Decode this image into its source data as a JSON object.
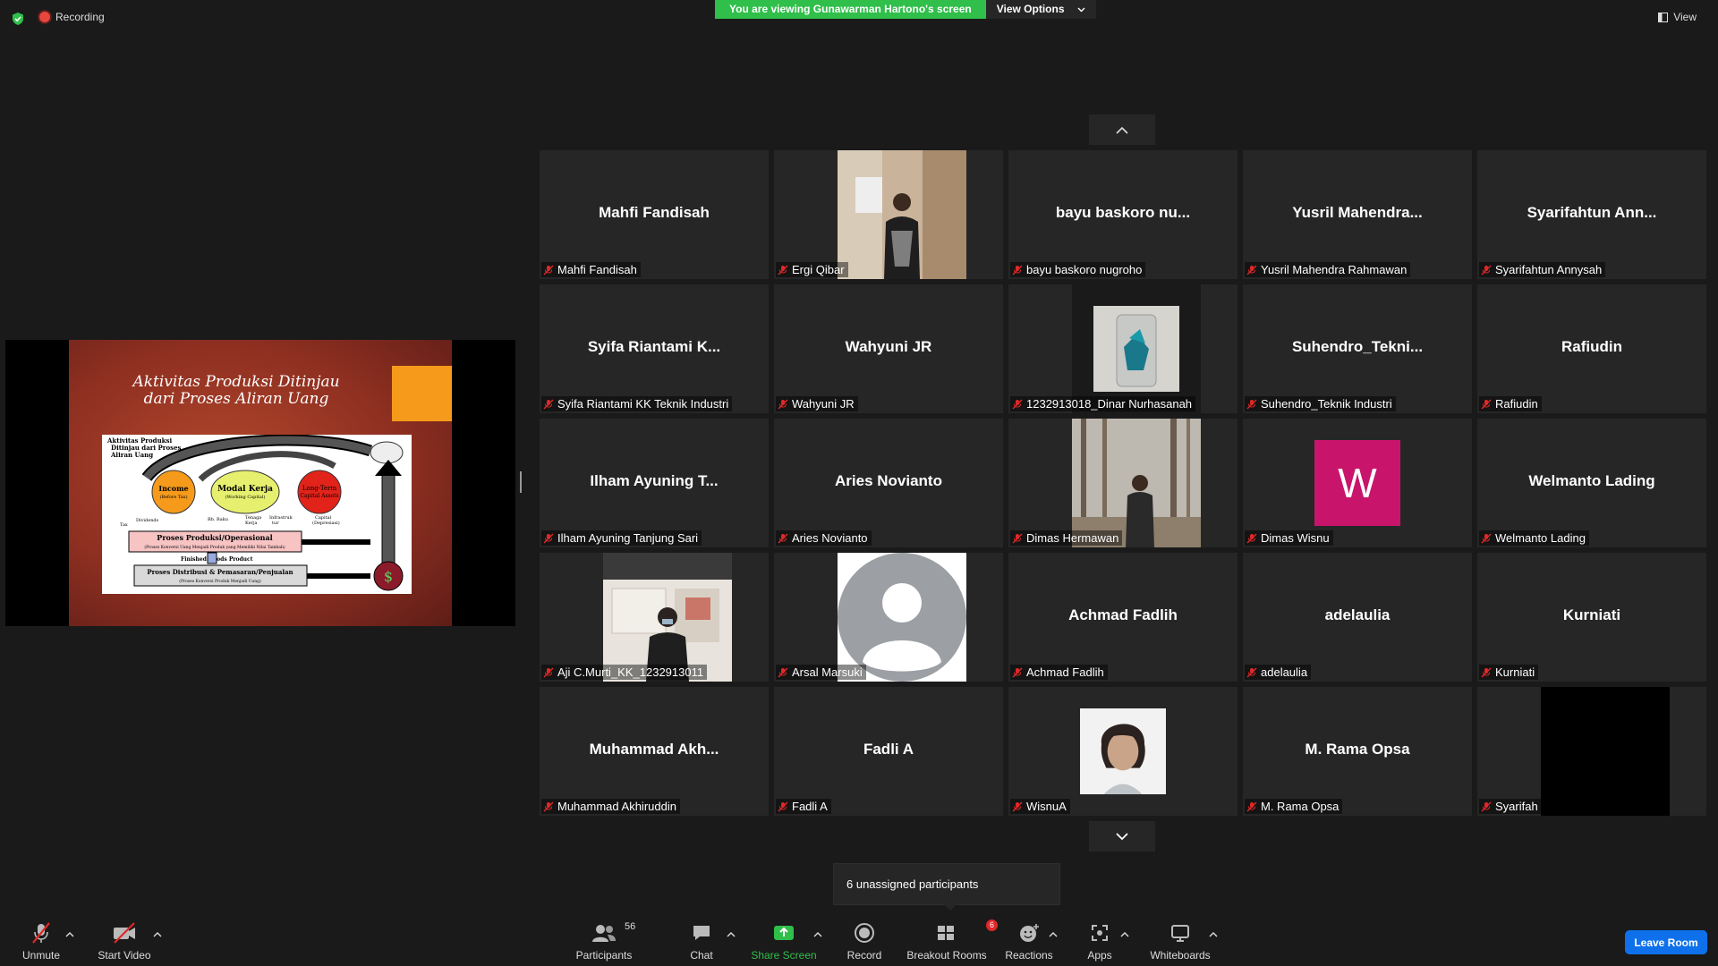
{
  "top": {
    "recording_label": "Recording",
    "banner_text": "You are viewing Gunawarman Hartono's screen",
    "view_options_label": "View Options",
    "view_label": "View"
  },
  "slide": {
    "title_line1": "Aktivitas Produksi Ditinjau",
    "title_line2": "dari Proses Aliran Uang",
    "diagram": {
      "heading1": "Aktivitas Produksi",
      "heading2": "Ditinjau dari Proses",
      "heading3": "Aliran Uang",
      "income": "Income",
      "income_sub": "(Before Tax)",
      "modal": "Modal Kerja",
      "modal_sub": "(Working Capital)",
      "longterm": "Long-Term",
      "longterm_sub": "Capital Assets",
      "dividends": "Dividends",
      "tax": "Tax",
      "bb": "Bb. Baku",
      "tenaga1": "Tenaga",
      "tenaga2": "Kerja",
      "infra1": "Infrastruk",
      "infra2": "tur",
      "capital1": "Capital",
      "capital2": "(Depresiasi)",
      "proses_prod": "Proses Produksi/Operasional",
      "proses_prod_sub": "(Proses Konversi Uang Menjadi Produk yang Memiliki Nilai Tambah)",
      "finished": "Finished Goods Product",
      "proses_dist": "Proses Distribusi & Pemasaran/Penjualan",
      "proses_dist_sub": "(Proses Konversi Produk Menjadi Uang)",
      "dollar": "$"
    }
  },
  "participants": [
    {
      "big": "Mahfi Fandisah",
      "label": "Mahfi Fandisah"
    },
    {
      "big": "",
      "label": "Ergi Qibar",
      "video": "photo-man-mirror"
    },
    {
      "big": "bayu baskoro nu...",
      "label": "bayu baskoro nugroho"
    },
    {
      "big": "Yusril Mahendra...",
      "label": "Yusril Mahendra Rahmawan"
    },
    {
      "big": "Syarifahtun Ann...",
      "label": "Syarifahtun Annysah"
    },
    {
      "big": "Syifa Riantami K...",
      "label": "Syifa Riantami KK Teknik Industri"
    },
    {
      "big": "Wahyuni JR",
      "label": "Wahyuni JR"
    },
    {
      "big": "",
      "label": "1232913018_Dinar Nurhasanah",
      "video": "photo-crystal-jar"
    },
    {
      "big": "Suhendro_Tekni...",
      "label": "Suhendro_Teknik Industri"
    },
    {
      "big": "Rafiudin",
      "label": "Rafiudin"
    },
    {
      "big": "Ilham Ayuning T...",
      "label": "Ilham Ayuning Tanjung Sari"
    },
    {
      "big": "Aries Novianto",
      "label": "Aries Novianto"
    },
    {
      "big": "",
      "label": "Dimas Hermawan",
      "video": "photo-forest-man"
    },
    {
      "big": "W",
      "label": "Dimas Wisnu",
      "avatar": true
    },
    {
      "big": "Welmanto Lading",
      "label": "Welmanto Lading"
    },
    {
      "big": "",
      "label": "Aji C.Murti_KK_1232913011",
      "video": "photo-man-mask"
    },
    {
      "big": "",
      "label": "Arsal Marsuki",
      "video": "default-avatar"
    },
    {
      "big": "Achmad Fadlih",
      "label": "Achmad Fadlih"
    },
    {
      "big": "adelaulia",
      "label": "adelaulia"
    },
    {
      "big": "Kurniati",
      "label": "Kurniati"
    },
    {
      "big": "Muhammad Akh...",
      "label": "Muhammad Akhiruddin"
    },
    {
      "big": "Fadli A",
      "label": "Fadli A"
    },
    {
      "big": "",
      "label": "WisnuA",
      "video": "photo-portrait"
    },
    {
      "big": "M. Rama Opsa",
      "label": "M. Rama Opsa"
    },
    {
      "big": "",
      "label": "Syarifah",
      "video": "black"
    }
  ],
  "notice": "6 unassigned participants",
  "toolbar": {
    "unmute": "Unmute",
    "start_video": "Start Video",
    "participants": "Participants",
    "participants_count": "56",
    "chat": "Chat",
    "share_screen": "Share Screen",
    "record": "Record",
    "breakout": "Breakout Rooms",
    "breakout_count": "6",
    "reactions": "Reactions",
    "apps": "Apps",
    "whiteboards": "Whiteboards",
    "leave": "Leave Room"
  },
  "colors": {
    "background": "#1a1a1a",
    "tile": "#262626",
    "banner_green": "#2fbf4a",
    "share_green": "#2fbf4a",
    "leave_blue": "#0e71eb",
    "mute_red": "#e02828"
  }
}
